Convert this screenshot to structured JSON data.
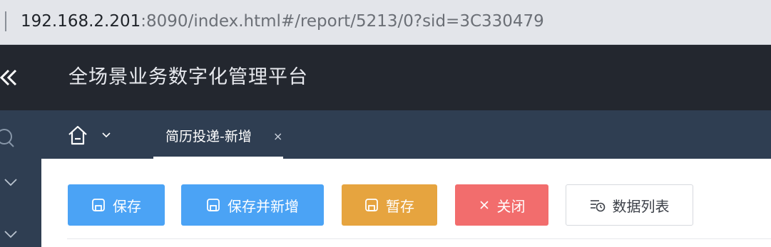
{
  "browser": {
    "url_host": "192.168.2.201",
    "url_rest": ":8090/index.html#/report/5213/0?sid=3C330479"
  },
  "header": {
    "title": "全场景业务数字化管理平台",
    "collapse_icon": "double-chevron-left-icon"
  },
  "sidebar": {
    "icons": [
      "search-icon",
      "chevron-down-icon",
      "chevron-down-icon"
    ]
  },
  "tabs": {
    "home_icon": "home-icon",
    "items": [
      {
        "label": "简历投递-新增",
        "close": "×",
        "active": true
      }
    ]
  },
  "toolbar": {
    "save_label": "保存",
    "save_new_label": "保存并新增",
    "draft_label": "暂存",
    "close_label": "关闭",
    "list_label": "数据列表"
  },
  "colors": {
    "primary": "#4ba3f5",
    "warning": "#e6a43f",
    "danger": "#f26d6d",
    "header_bg": "#23272f",
    "nav_bg": "#2f3e52"
  }
}
